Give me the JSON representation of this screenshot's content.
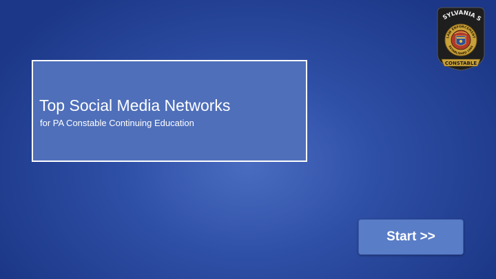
{
  "slide": {
    "title": "Top Social Media Networks",
    "subtitle": "for PA Constable Continuing Education"
  },
  "badge": {
    "top_text": "PENNSYLVANIA STATE",
    "bottom_text": "CONSTABLE",
    "ring_top_text": "LAW ENFORCEMENT",
    "ring_bottom_text": "ESTABLISHED 1664",
    "icon": "pennsylvania-constable-badge-icon"
  },
  "start_button": {
    "label": "Start >>"
  },
  "colors": {
    "background_center": "#4a6cc0",
    "background_edge": "#1c3787",
    "title_box_fill": "#4f6fba",
    "button_fill": "#5a7dc8",
    "text": "#ffffff"
  }
}
